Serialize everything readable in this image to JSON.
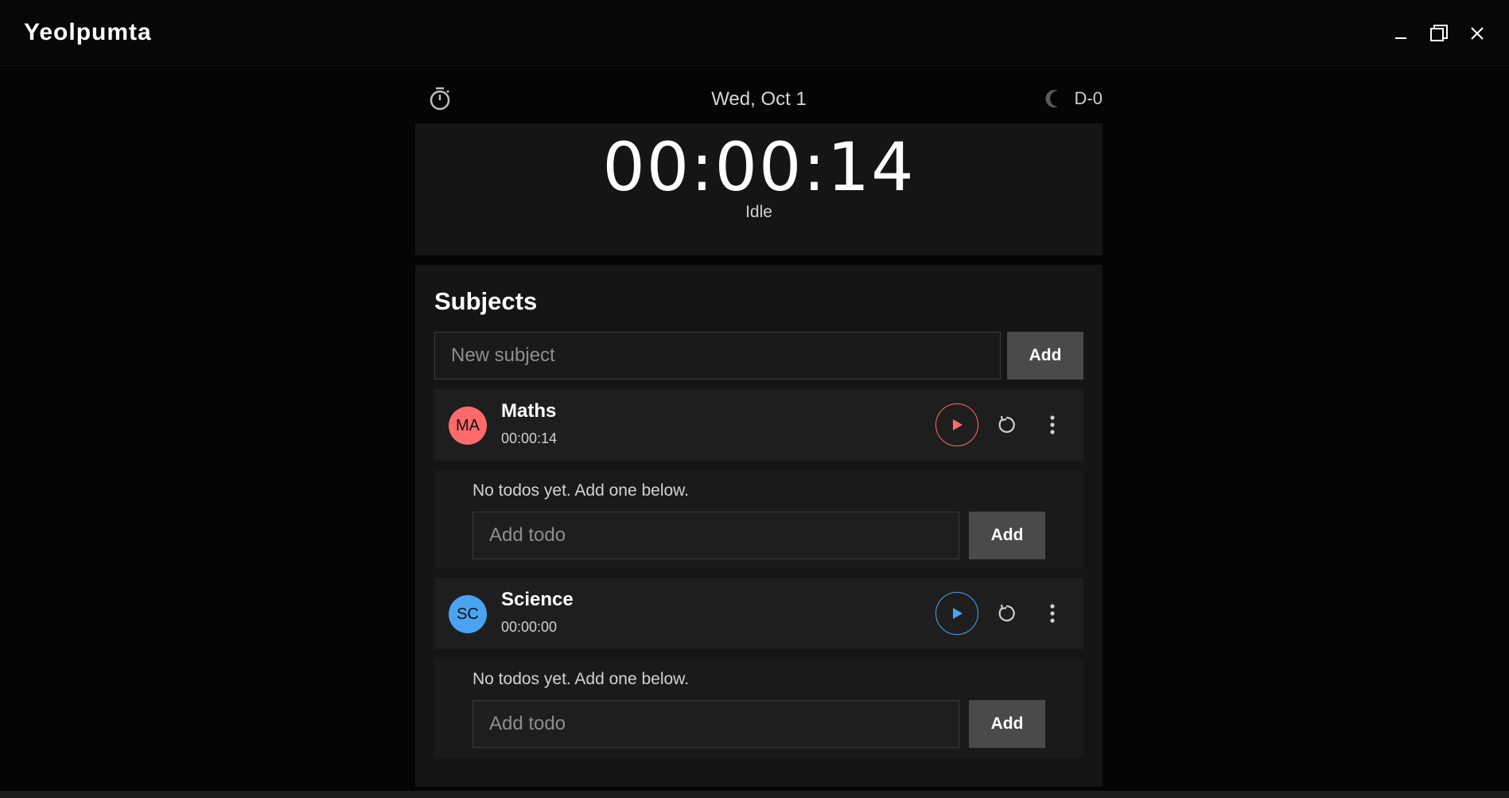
{
  "app": {
    "title": "Yeolpumta"
  },
  "window_controls": [
    "minimize-icon",
    "maximize-icon",
    "close-icon"
  ],
  "header": {
    "date": "Wed, Oct 1",
    "dday": "D-0",
    "left_icon": "timer-icon",
    "theme_icon": "moon-icon"
  },
  "clock": {
    "time": "00:00:14",
    "status": "Idle"
  },
  "subjects": {
    "title": "Subjects",
    "input_placeholder": "New subject",
    "add_label": "Add",
    "items": [
      {
        "initials": "MA",
        "name": "Maths",
        "time": "00:00:14",
        "color": "#ff6b6b",
        "todo_empty": "No todos yet. Add one below.",
        "todo_placeholder": "Add todo",
        "todo_add_label": "Add"
      },
      {
        "initials": "SC",
        "name": "Science",
        "time": "00:00:00",
        "color": "#4aa3f0",
        "todo_empty": "No todos yet. Add one below.",
        "todo_placeholder": "Add todo",
        "todo_add_label": "Add"
      }
    ]
  },
  "colors": {
    "background": "#050505",
    "card": "#151515",
    "button": "#4a4a4a",
    "maths_accent": "#ff6b6b",
    "science_accent": "#4aa3f0"
  }
}
